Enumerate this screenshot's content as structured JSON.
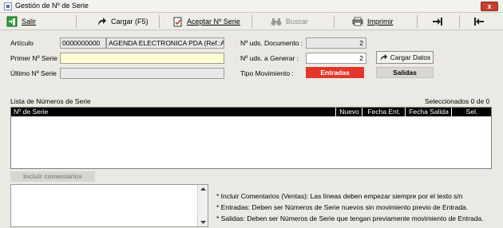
{
  "window": {
    "title": "Gestión de Nº de Serie",
    "close_glyph": "x"
  },
  "toolbar": {
    "salir": {
      "label": "Salir",
      "icon": "exit-door-icon"
    },
    "cargar": {
      "label": "Cargar (F5)",
      "icon": "curved-arrow-icon"
    },
    "aceptar": {
      "label": "Aceptar Nº Serie",
      "icon": "document-check-icon"
    },
    "buscar": {
      "label": "Buscar",
      "icon": "binoculars-icon"
    },
    "imprimir": {
      "label": "Imprimir",
      "icon": "printer-icon"
    },
    "nav_next": {
      "icon": "arrow-right-end-icon"
    },
    "nav_back": {
      "icon": "arrow-left-end-icon"
    }
  },
  "form": {
    "articulo_label": "Artículo",
    "articulo_code": "0000000000",
    "articulo_desc": "AGENDA ELECTRONICA PDA (Ref.:A(",
    "primer_label": "Primer Nº Serie",
    "primer_value": "",
    "ultimo_label": "Último Nº Serie",
    "ultimo_value": "",
    "uds_doc_label": "Nº uds. Documento :",
    "uds_doc_value": "2",
    "uds_gen_label": "Nº uds. a Generar :",
    "uds_gen_value": "2",
    "tipo_label": "Tipo Movimiento :",
    "entradas_label": "Entradas",
    "salidas_label": "Salidas",
    "cargar_datos_label": "Cargar Datos"
  },
  "list": {
    "title": "Lista de Números de Serie",
    "selected": "Seleccionados 0 de 0",
    "columns": [
      "Nº de Serie",
      "Nuevo",
      "Fecha Ent.",
      "Fecha Salida",
      "Sel."
    ]
  },
  "comments": {
    "button_label": "Incluir comentarios",
    "value": ""
  },
  "notes": [
    "* Incluir Comentarios (Ventas): Las líneas deben empezar siempre por el texto s/n",
    "* Entradas: Deben ser Números de Serie nuevos sin movimiento previo de Entrada.",
    "* Salidas: Deben ser Números de Serie que tengan previamente movimiento de Entrada."
  ],
  "colors": {
    "entradas_active": "#e2372a",
    "list_header_bg": "#000000",
    "primer_field_bg": "#ffffd2"
  }
}
